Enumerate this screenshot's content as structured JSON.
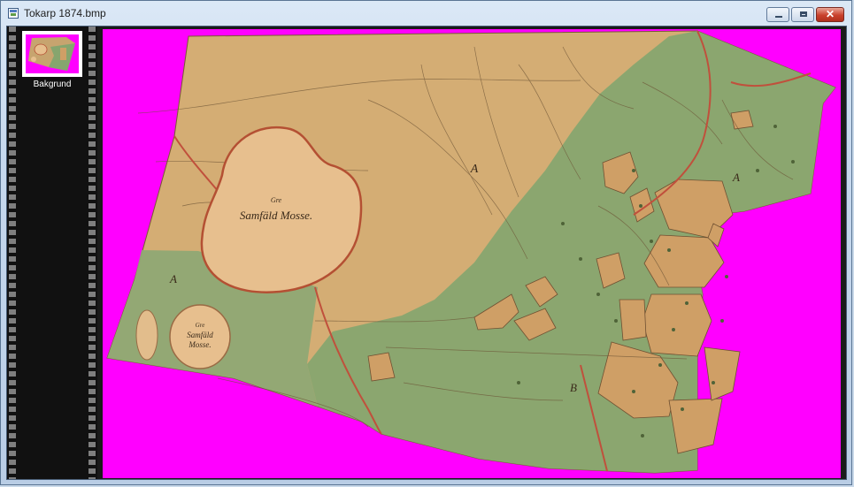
{
  "window": {
    "title": "Tokarp 1874.bmp"
  },
  "caption_buttons": {
    "minimize_icon": "minimize-icon",
    "maximize_icon": "maximize-icon",
    "close_icon": "close-icon",
    "close_glyph": "✕"
  },
  "filmstrip": {
    "items": [
      {
        "label": "Bakgrund",
        "selected": true
      }
    ]
  },
  "map": {
    "labels": {
      "samfald_main_1": "Gre",
      "samfald_main_2": "Samfäld Mosse.",
      "samfald_small_1": "Gre",
      "samfald_small_2": "Samfäld",
      "samfald_small_3": "Mosse.",
      "region_a1": "A",
      "region_a2": "A",
      "region_a3": "A",
      "region_b": "B"
    }
  },
  "colors": {
    "background_fill": "#ff00ff",
    "parchment": "#d4ad74",
    "meadow": "#87a56f",
    "boundary_red": "#c0503c",
    "filmstrip": "#111111"
  }
}
